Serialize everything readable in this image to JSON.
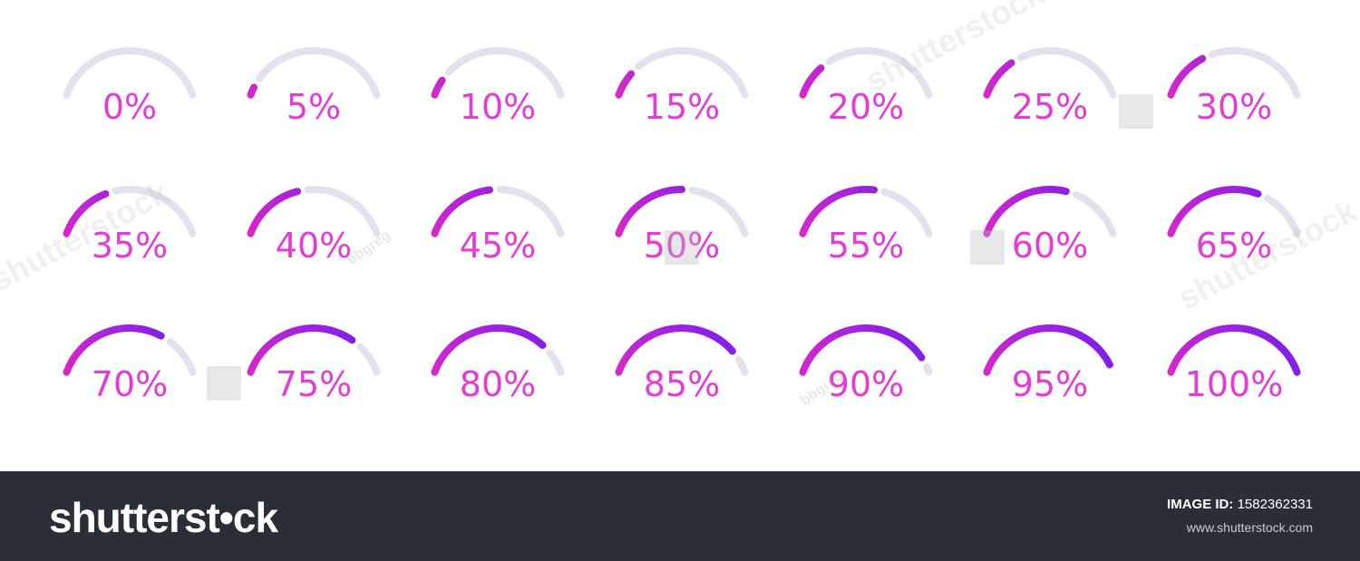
{
  "colors": {
    "track": "#e3e1ee",
    "gradient_start": "#f02bc0",
    "gradient_end": "#6c1cf2",
    "label": "#e43cd6",
    "footer_background": "#2a2e37"
  },
  "gauges": [
    {
      "label": "0%",
      "value": 0
    },
    {
      "label": "5%",
      "value": 5
    },
    {
      "label": "10%",
      "value": 10
    },
    {
      "label": "15%",
      "value": 15
    },
    {
      "label": "20%",
      "value": 20
    },
    {
      "label": "25%",
      "value": 25
    },
    {
      "label": "30%",
      "value": 30
    },
    {
      "label": "35%",
      "value": 35
    },
    {
      "label": "40%",
      "value": 40
    },
    {
      "label": "45%",
      "value": 45
    },
    {
      "label": "50%",
      "value": 50
    },
    {
      "label": "55%",
      "value": 55
    },
    {
      "label": "60%",
      "value": 60
    },
    {
      "label": "65%",
      "value": 65
    },
    {
      "label": "70%",
      "value": 70
    },
    {
      "label": "75%",
      "value": 75
    },
    {
      "label": "80%",
      "value": 80
    },
    {
      "label": "85%",
      "value": 85
    },
    {
      "label": "90%",
      "value": 90
    },
    {
      "label": "95%",
      "value": 95
    },
    {
      "label": "100%",
      "value": 100
    }
  ],
  "watermark": {
    "text": "shutterstock",
    "contributor": "bbgreg"
  },
  "footer": {
    "logo": "shutterst•ck",
    "image_id_label": "IMAGE ID:",
    "image_id_value": "1582362331",
    "url": "www.shutterstock.com"
  }
}
